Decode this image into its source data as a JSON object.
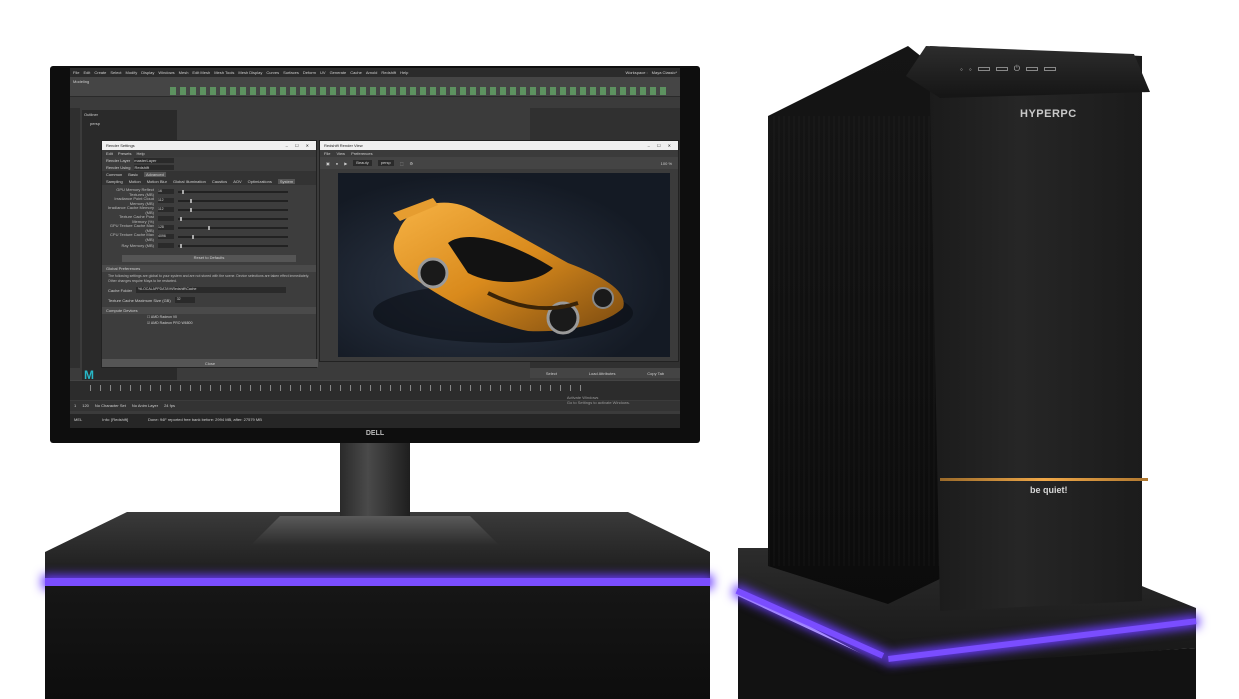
{
  "scene": {
    "monitor_brand": "DELL",
    "case_brand": "HYPERPC",
    "case_brand_secondary": "be quiet!",
    "accent_glow_color": "#7a4dff",
    "case_strip_color": "#f0a848"
  },
  "maya": {
    "menu": [
      "File",
      "Edit",
      "Create",
      "Select",
      "Modify",
      "Display",
      "Windows",
      "Mesh",
      "Edit Mesh",
      "Mesh Tools",
      "Mesh Display",
      "Curves",
      "Surfaces",
      "Deform",
      "UV",
      "Generate",
      "Cache",
      "Arnold",
      "Redshift",
      "Help"
    ],
    "workspace_label": "Workspace :",
    "workspace_value": "Maya Classic*",
    "mode": "Modeling",
    "outliner_title": "Outliner",
    "camera": "persp",
    "status_info": "Info: [Redshift]",
    "status_done": "Done: 94F reported free bank before: 2994 MB, after: 27579 MB",
    "activate_line1": "Activate Windows",
    "activate_line2": "Go to Settings to activate Windows.",
    "no_character_set": "No Character Set",
    "no_anim_layer": "No Anim Layer",
    "fps": "24 fps",
    "range_start": "1",
    "range_end": "120",
    "mel_label": "MEL",
    "attr_buttons": [
      "Select",
      "Load Attributes",
      "Copy Tab"
    ]
  },
  "render_settings": {
    "title": "Render Settings",
    "menu": [
      "Edit",
      "Presets",
      "Help"
    ],
    "render_layer_label": "Render Layer",
    "render_layer_value": "masterLayer",
    "render_using_label": "Render Using",
    "render_using_value": "Redshift",
    "top_tabs": [
      "Common",
      "Basic",
      "Advanced"
    ],
    "sub_tabs": [
      "Sampling",
      "Motion",
      "Motion Blur",
      "Global Illumination",
      "Caustics",
      "AOV",
      "Optimizations",
      "System"
    ],
    "params": [
      {
        "label": "GPU Memory Reflect Textures (MB)",
        "value": "16"
      },
      {
        "label": "Irradiance Point Cloud Memory (MB)",
        "value": "112"
      },
      {
        "label": "Irradiance Cache Memory (MB)",
        "value": "112"
      },
      {
        "label": "Texture Cache Post Memory (%)",
        "value": ""
      },
      {
        "label": "GPU Texture Cache Max (MB)",
        "value": "128"
      },
      {
        "label": "CPU Texture Cache Max (MB)",
        "value": "4096"
      },
      {
        "label": "Ray Memory (MB)",
        "value": ""
      }
    ],
    "reset_label": "Reset to Defaults",
    "global_prefs_label": "Global Preferences",
    "global_prefs_text": "The following settings are global to your system and are not stored with the scene. Device selections are taken effect immediately. Other changes require Maya to be restarted.",
    "cache_folder_label": "Cache Folder",
    "cache_folder_value": "%LOCALAPPDATA%\\Redshift\\Cache",
    "texture_cache_label": "Texture Cache Maximum Size (GB)",
    "texture_cache_value": "32",
    "compute_devices_label": "Compute Devices",
    "devices": [
      "AMD Radeon VII",
      "AMD Radeon PRO W6800"
    ],
    "close_label": "Close"
  },
  "render_view": {
    "title": "Redshift Render View",
    "menu": [
      "File",
      "View",
      "Preferences"
    ],
    "beauty": "Beauty",
    "camera": "persp",
    "zoom": "100 %"
  }
}
